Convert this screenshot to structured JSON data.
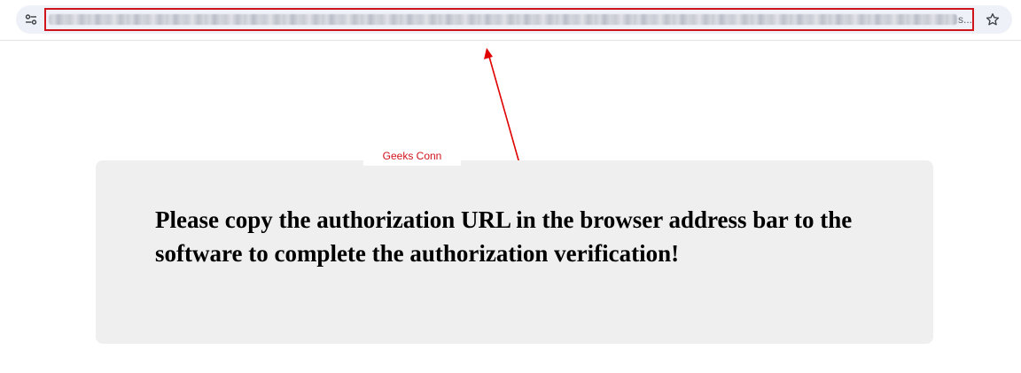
{
  "browser": {
    "url_ellipsis": "s...",
    "icons": {
      "site_settings": "tune-icon",
      "bookmark": "star-outline-icon"
    },
    "highlight_color": "#d0141c"
  },
  "annotation": {
    "watermark": "Geeks Conn",
    "arrow_color": "#e00000"
  },
  "card": {
    "message": "Please copy the authorization URL in the browser address bar to the software to complete the authorization verification!"
  }
}
